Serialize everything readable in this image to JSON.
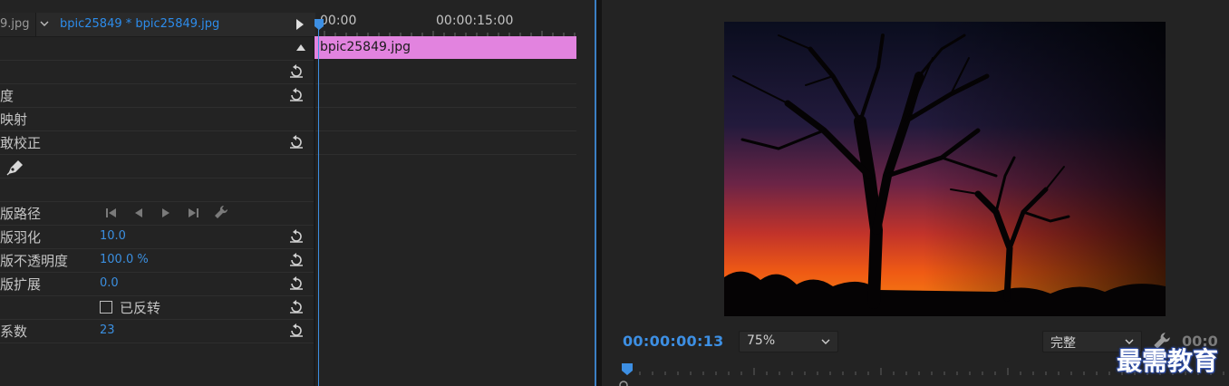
{
  "effect_controls": {
    "tabs": [
      {
        "label": "9.jpg",
        "active": false
      },
      {
        "label": "bpic25849 * bpic25849.jpg",
        "active": true
      }
    ],
    "properties": [
      {
        "label": "",
        "value": "",
        "reset": false,
        "collapse": true
      },
      {
        "label": "",
        "value": "",
        "reset": true
      },
      {
        "label": "度",
        "value": "",
        "reset": true
      },
      {
        "label": "映射",
        "value": "",
        "reset": false
      },
      {
        "label": "敢校正",
        "value": "",
        "reset": true
      },
      {
        "label": "",
        "value": "",
        "reset": false,
        "pen": true
      },
      {
        "label": "",
        "value": "",
        "reset": false
      },
      {
        "label": "版路径",
        "value": "",
        "reset": false,
        "track_controls": true
      },
      {
        "label": "版羽化",
        "value": "10.0",
        "reset": true
      },
      {
        "label": "版不透明度",
        "value": "100.0 %",
        "reset": true
      },
      {
        "label": "版扩展",
        "value": "0.0",
        "reset": true
      },
      {
        "label": "",
        "value": "",
        "reset": true,
        "checkbox": "已反转"
      },
      {
        "label": "系数",
        "value": "23",
        "reset": true
      }
    ]
  },
  "timeline": {
    "start_tc": "00:00",
    "mid_tc": "00:00:15:00",
    "clip_name": "bpic25849.jpg",
    "clip_color": "#e283df"
  },
  "monitor": {
    "timecode": "00:00:00:13",
    "zoom": "75%",
    "quality": "完整",
    "right_timecode": "00:0",
    "watermark": "最需教育"
  },
  "colors": {
    "accent": "#3d8fe3",
    "value_blue": "#3b8fe0"
  }
}
